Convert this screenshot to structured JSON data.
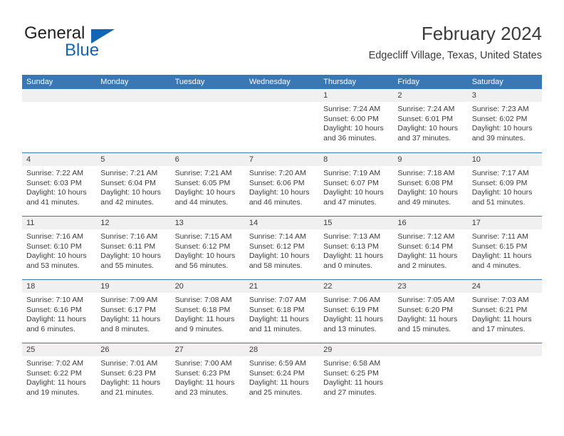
{
  "brand": {
    "name_top": "General",
    "name_bottom": "Blue",
    "accent_color": "#1464b4"
  },
  "header": {
    "title": "February 2024",
    "subtitle": "Edgecliff Village, Texas, United States"
  },
  "theme": {
    "header_bar_color": "#3a77b5",
    "date_strip_color": "#f0f0f0",
    "text_color": "#3b3b3b"
  },
  "weekdays": [
    "Sunday",
    "Monday",
    "Tuesday",
    "Wednesday",
    "Thursday",
    "Friday",
    "Saturday"
  ],
  "weeks": [
    [
      {
        "empty": true
      },
      {
        "empty": true
      },
      {
        "empty": true
      },
      {
        "empty": true
      },
      {
        "day": "1",
        "sunrise": "Sunrise: 7:24 AM",
        "sunset": "Sunset: 6:00 PM",
        "daylight": "Daylight: 10 hours and 36 minutes."
      },
      {
        "day": "2",
        "sunrise": "Sunrise: 7:24 AM",
        "sunset": "Sunset: 6:01 PM",
        "daylight": "Daylight: 10 hours and 37 minutes."
      },
      {
        "day": "3",
        "sunrise": "Sunrise: 7:23 AM",
        "sunset": "Sunset: 6:02 PM",
        "daylight": "Daylight: 10 hours and 39 minutes."
      }
    ],
    [
      {
        "day": "4",
        "sunrise": "Sunrise: 7:22 AM",
        "sunset": "Sunset: 6:03 PM",
        "daylight": "Daylight: 10 hours and 41 minutes."
      },
      {
        "day": "5",
        "sunrise": "Sunrise: 7:21 AM",
        "sunset": "Sunset: 6:04 PM",
        "daylight": "Daylight: 10 hours and 42 minutes."
      },
      {
        "day": "6",
        "sunrise": "Sunrise: 7:21 AM",
        "sunset": "Sunset: 6:05 PM",
        "daylight": "Daylight: 10 hours and 44 minutes."
      },
      {
        "day": "7",
        "sunrise": "Sunrise: 7:20 AM",
        "sunset": "Sunset: 6:06 PM",
        "daylight": "Daylight: 10 hours and 46 minutes."
      },
      {
        "day": "8",
        "sunrise": "Sunrise: 7:19 AM",
        "sunset": "Sunset: 6:07 PM",
        "daylight": "Daylight: 10 hours and 47 minutes."
      },
      {
        "day": "9",
        "sunrise": "Sunrise: 7:18 AM",
        "sunset": "Sunset: 6:08 PM",
        "daylight": "Daylight: 10 hours and 49 minutes."
      },
      {
        "day": "10",
        "sunrise": "Sunrise: 7:17 AM",
        "sunset": "Sunset: 6:09 PM",
        "daylight": "Daylight: 10 hours and 51 minutes."
      }
    ],
    [
      {
        "day": "11",
        "sunrise": "Sunrise: 7:16 AM",
        "sunset": "Sunset: 6:10 PM",
        "daylight": "Daylight: 10 hours and 53 minutes."
      },
      {
        "day": "12",
        "sunrise": "Sunrise: 7:16 AM",
        "sunset": "Sunset: 6:11 PM",
        "daylight": "Daylight: 10 hours and 55 minutes."
      },
      {
        "day": "13",
        "sunrise": "Sunrise: 7:15 AM",
        "sunset": "Sunset: 6:12 PM",
        "daylight": "Daylight: 10 hours and 56 minutes."
      },
      {
        "day": "14",
        "sunrise": "Sunrise: 7:14 AM",
        "sunset": "Sunset: 6:12 PM",
        "daylight": "Daylight: 10 hours and 58 minutes."
      },
      {
        "day": "15",
        "sunrise": "Sunrise: 7:13 AM",
        "sunset": "Sunset: 6:13 PM",
        "daylight": "Daylight: 11 hours and 0 minutes."
      },
      {
        "day": "16",
        "sunrise": "Sunrise: 7:12 AM",
        "sunset": "Sunset: 6:14 PM",
        "daylight": "Daylight: 11 hours and 2 minutes."
      },
      {
        "day": "17",
        "sunrise": "Sunrise: 7:11 AM",
        "sunset": "Sunset: 6:15 PM",
        "daylight": "Daylight: 11 hours and 4 minutes."
      }
    ],
    [
      {
        "day": "18",
        "sunrise": "Sunrise: 7:10 AM",
        "sunset": "Sunset: 6:16 PM",
        "daylight": "Daylight: 11 hours and 6 minutes."
      },
      {
        "day": "19",
        "sunrise": "Sunrise: 7:09 AM",
        "sunset": "Sunset: 6:17 PM",
        "daylight": "Daylight: 11 hours and 8 minutes."
      },
      {
        "day": "20",
        "sunrise": "Sunrise: 7:08 AM",
        "sunset": "Sunset: 6:18 PM",
        "daylight": "Daylight: 11 hours and 9 minutes."
      },
      {
        "day": "21",
        "sunrise": "Sunrise: 7:07 AM",
        "sunset": "Sunset: 6:18 PM",
        "daylight": "Daylight: 11 hours and 11 minutes."
      },
      {
        "day": "22",
        "sunrise": "Sunrise: 7:06 AM",
        "sunset": "Sunset: 6:19 PM",
        "daylight": "Daylight: 11 hours and 13 minutes."
      },
      {
        "day": "23",
        "sunrise": "Sunrise: 7:05 AM",
        "sunset": "Sunset: 6:20 PM",
        "daylight": "Daylight: 11 hours and 15 minutes."
      },
      {
        "day": "24",
        "sunrise": "Sunrise: 7:03 AM",
        "sunset": "Sunset: 6:21 PM",
        "daylight": "Daylight: 11 hours and 17 minutes."
      }
    ],
    [
      {
        "day": "25",
        "sunrise": "Sunrise: 7:02 AM",
        "sunset": "Sunset: 6:22 PM",
        "daylight": "Daylight: 11 hours and 19 minutes."
      },
      {
        "day": "26",
        "sunrise": "Sunrise: 7:01 AM",
        "sunset": "Sunset: 6:23 PM",
        "daylight": "Daylight: 11 hours and 21 minutes."
      },
      {
        "day": "27",
        "sunrise": "Sunrise: 7:00 AM",
        "sunset": "Sunset: 6:23 PM",
        "daylight": "Daylight: 11 hours and 23 minutes."
      },
      {
        "day": "28",
        "sunrise": "Sunrise: 6:59 AM",
        "sunset": "Sunset: 6:24 PM",
        "daylight": "Daylight: 11 hours and 25 minutes."
      },
      {
        "day": "29",
        "sunrise": "Sunrise: 6:58 AM",
        "sunset": "Sunset: 6:25 PM",
        "daylight": "Daylight: 11 hours and 27 minutes."
      },
      {
        "empty": true
      },
      {
        "empty": true
      }
    ]
  ]
}
